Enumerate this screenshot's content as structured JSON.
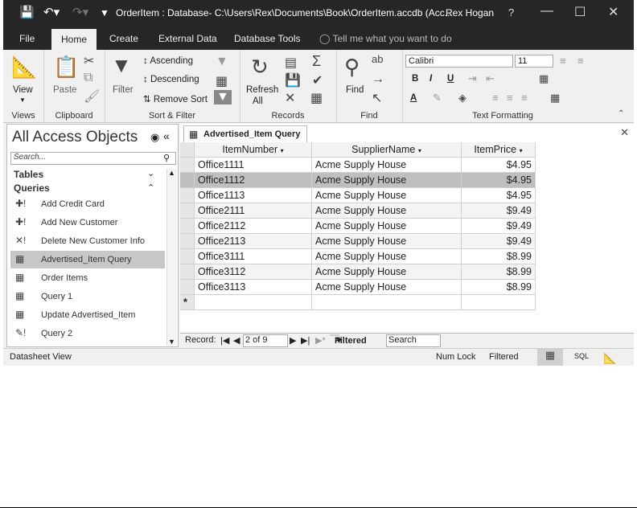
{
  "title_bar": {
    "title": "OrderItem : Database- C:\\Users\\Rex\\Documents\\Book\\OrderItem.accdb (Acc...",
    "user": "Rex Hogan",
    "help": "?"
  },
  "tabs": [
    "File",
    "Home",
    "Create",
    "External Data",
    "Database Tools"
  ],
  "tell_me": "Tell me what you want to do",
  "ribbon": {
    "views": {
      "view_label": "View",
      "group": "Views"
    },
    "clipboard": {
      "paste_label": "Paste",
      "group": "Clipboard"
    },
    "sort_filter": {
      "filter_label": "Filter",
      "ascending": "Ascending",
      "descending": "Descending",
      "remove_sort": "Remove Sort",
      "group": "Sort & Filter"
    },
    "records": {
      "refresh_label": "Refresh",
      "all_label": "All",
      "group": "Records"
    },
    "find": {
      "find_label": "Find",
      "group": "Find"
    },
    "text_formatting": {
      "font": "Calibri",
      "size": "11",
      "bold": "B",
      "italic": "I",
      "underline": "U",
      "font_color": "A",
      "group": "Text Formatting"
    }
  },
  "nav_pane": {
    "title": "All Access Objects",
    "search_placeholder": "Search...",
    "tables_header": "Tables",
    "queries_header": "Queries",
    "items": [
      {
        "label": "Add Credit Card",
        "icon": "append-query-icon"
      },
      {
        "label": "Add New Customer",
        "icon": "append-query-icon"
      },
      {
        "label": "Delete New Customer Info",
        "icon": "delete-query-icon"
      },
      {
        "label": "Advertised_Item Query",
        "icon": "select-query-icon",
        "selected": true
      },
      {
        "label": "Order Items",
        "icon": "select-query-icon"
      },
      {
        "label": "Query 1",
        "icon": "select-query-icon"
      },
      {
        "label": "Update Advertised_Item",
        "icon": "select-query-icon"
      },
      {
        "label": "Query 2",
        "icon": "update-query-icon"
      }
    ]
  },
  "document": {
    "tab_label": "Advertised_Item Query",
    "columns": [
      "ItemNumber",
      "SupplierName",
      "ItemPrice"
    ],
    "rows": [
      [
        "Office1111",
        "Acme Supply House",
        "$4.95"
      ],
      [
        "Office1112",
        "Acme Supply House",
        "$4.95"
      ],
      [
        "Office1113",
        "Acme Supply House",
        "$4.95"
      ],
      [
        "Office2111",
        "Acme Supply House",
        "$9.49"
      ],
      [
        "Office2112",
        "Acme Supply House",
        "$9.49"
      ],
      [
        "Office2113",
        "Acme Supply House",
        "$9.49"
      ],
      [
        "Office3111",
        "Acme Supply House",
        "$8.99"
      ],
      [
        "Office3112",
        "Acme Supply House",
        "$8.99"
      ],
      [
        "Office3113",
        "Acme Supply House",
        "$8.99"
      ]
    ],
    "current_row": 1,
    "new_record_marker": "*"
  },
  "record_nav": {
    "label": "Record:",
    "position": "2 of 9",
    "filtered": "Filtered",
    "search": "Search"
  },
  "status_bar": {
    "left": "Datasheet View",
    "num_lock": "Num Lock",
    "filtered": "Filtered",
    "sql": "SQL"
  }
}
